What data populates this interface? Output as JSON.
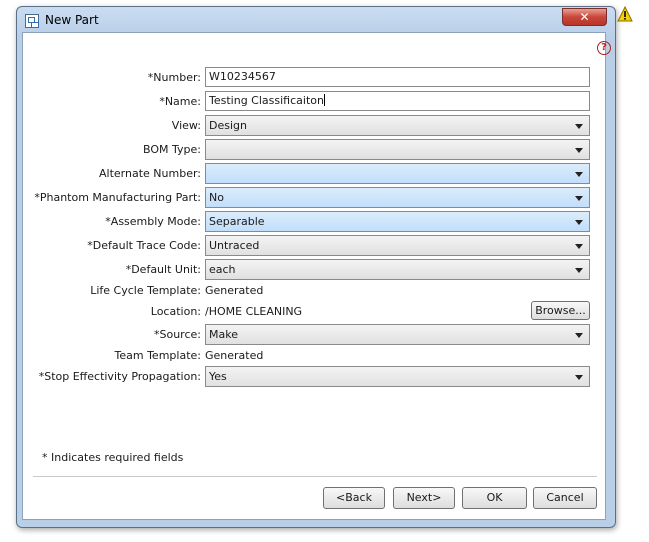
{
  "window": {
    "title": "New Part",
    "close_label": "✕"
  },
  "help": {
    "label": "?"
  },
  "form": {
    "number": {
      "label": "*Number:",
      "value": "W10234567"
    },
    "name": {
      "label": "*Name:",
      "value": "Testing Classificaiton"
    },
    "view": {
      "label": "View:",
      "value": "Design"
    },
    "bom_type": {
      "label": "BOM Type:",
      "value": ""
    },
    "alternate_number": {
      "label": "Alternate Number:",
      "value": ""
    },
    "phantom": {
      "label": "*Phantom Manufacturing Part:",
      "value": "No"
    },
    "assembly_mode": {
      "label": "*Assembly Mode:",
      "value": "Separable"
    },
    "trace_code": {
      "label": "*Default Trace Code:",
      "value": "Untraced"
    },
    "default_unit": {
      "label": "*Default Unit:",
      "value": "each"
    },
    "life_cycle": {
      "label": "Life Cycle Template:",
      "value": "Generated"
    },
    "location": {
      "label": "Location:",
      "value": "/HOME CLEANING",
      "browse_label": "Browse..."
    },
    "source": {
      "label": "*Source:",
      "value": "Make"
    },
    "team_template": {
      "label": "Team Template:",
      "value": "Generated"
    },
    "stop_effectivity": {
      "label": "*Stop Effectivity Propagation:",
      "value": "Yes"
    }
  },
  "footer": {
    "required_note": "* Indicates required fields",
    "back_label": "<Back",
    "next_label": "Next>",
    "ok_label": "OK",
    "cancel_label": "Cancel"
  },
  "colors": {
    "highlight_select": "#c2defa",
    "close_button": "#c8463a"
  }
}
